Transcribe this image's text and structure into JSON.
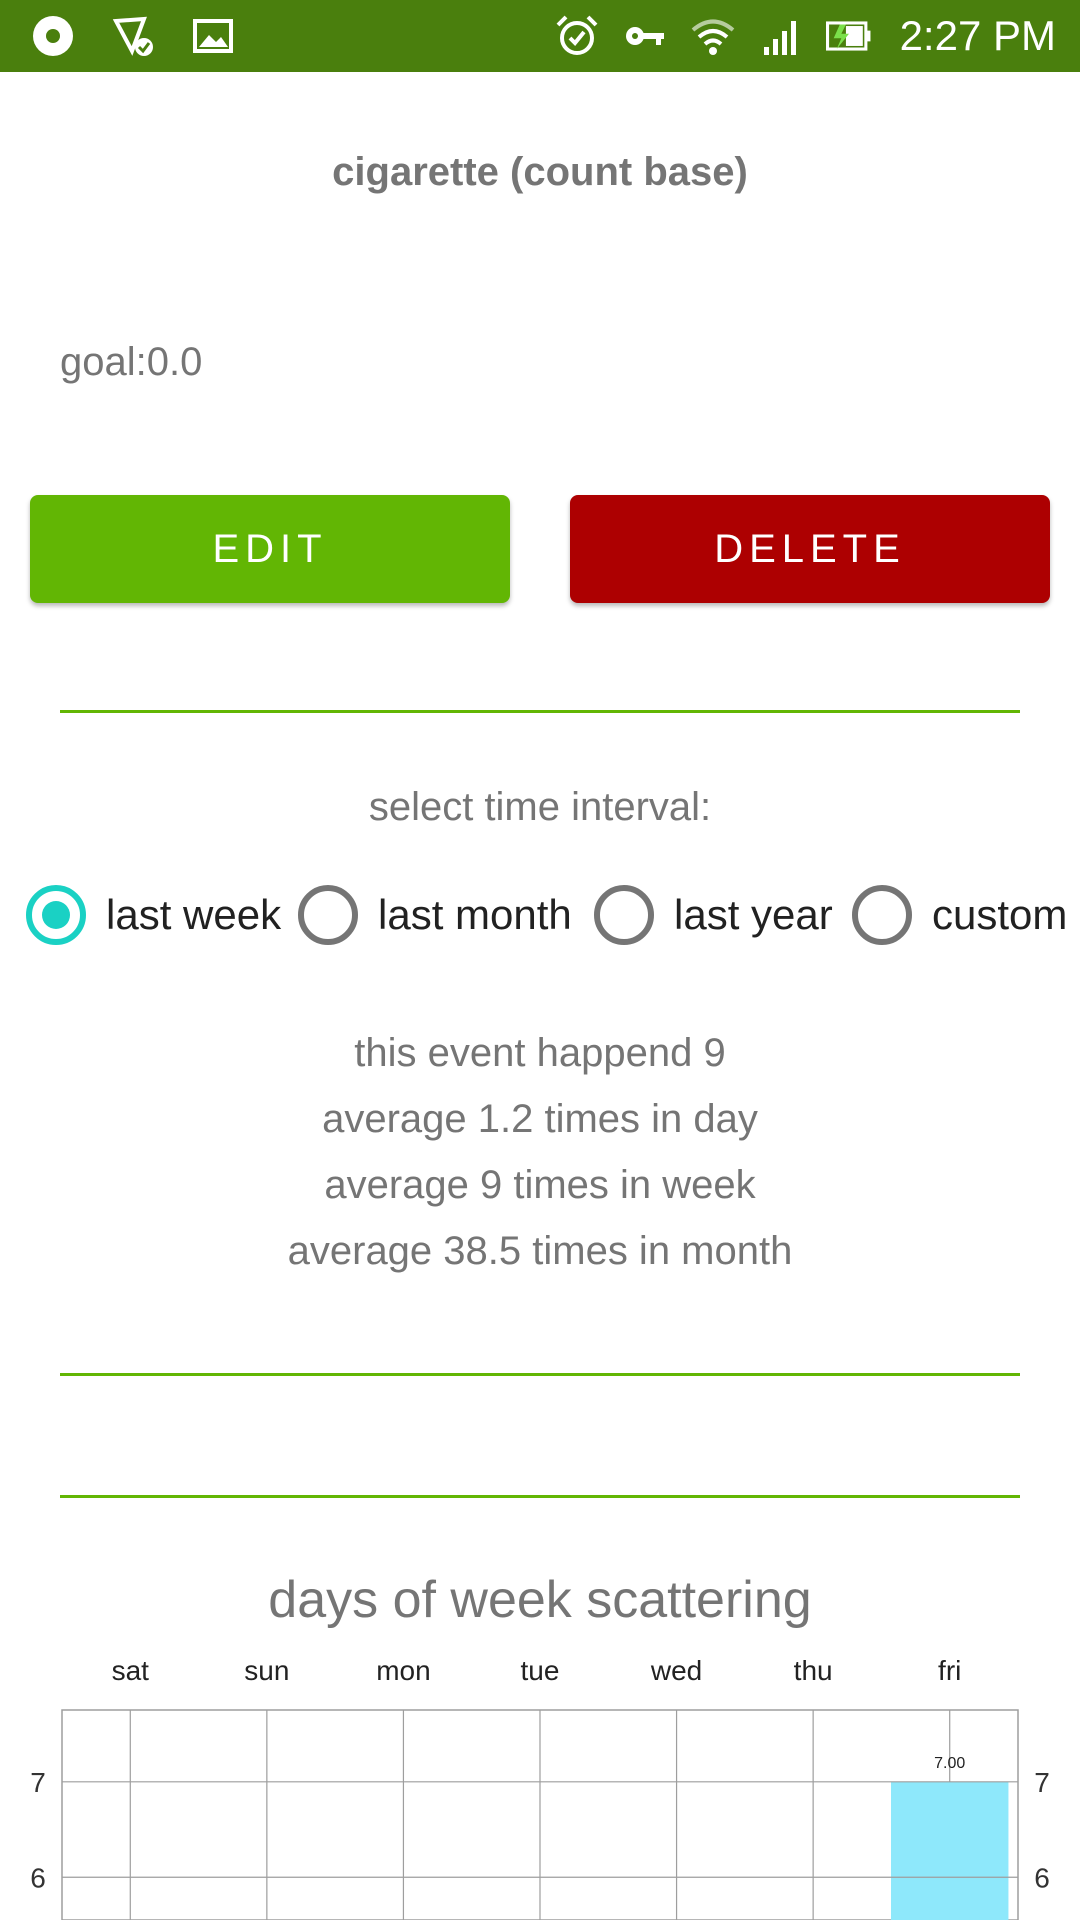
{
  "status_bar": {
    "time": "2:27 PM",
    "accent": "#4a7f0d"
  },
  "screen": {
    "title": "cigarette (count base)",
    "goal": "goal:0.0"
  },
  "actions": {
    "edit_label": "EDIT",
    "delete_label": "DELETE",
    "edit_color": "#62b604",
    "delete_color": "#ad0001"
  },
  "interval": {
    "label": "select time interval:",
    "options": [
      {
        "label": "last week",
        "checked": true
      },
      {
        "label": "last month",
        "checked": false
      },
      {
        "label": "last year",
        "checked": false
      },
      {
        "label": "custom",
        "checked": false
      }
    ],
    "checked_color": "#1ad1c4"
  },
  "stats": {
    "happened": "this event happend 9",
    "per_day": "average 1.2 times in day",
    "per_week": "average 9 times in week",
    "per_month": "average 38.5 times in month"
  },
  "chart_title": "days of week scattering",
  "chart_data": {
    "type": "bar",
    "title": "days of week scattering",
    "categories": [
      "sat",
      "sun",
      "mon",
      "tue",
      "wed",
      "thu",
      "fri"
    ],
    "values": [
      null,
      null,
      null,
      null,
      null,
      null,
      7
    ],
    "data_labels": [
      "",
      "",
      "",
      "",
      "",
      "",
      "7.00"
    ],
    "y_ticks_left": [
      "7",
      "6"
    ],
    "y_ticks_right": [
      "7",
      "6"
    ],
    "ylim_visible": [
      5.5,
      7.7
    ],
    "grid": true,
    "bar_color": "#8ee8fb"
  }
}
